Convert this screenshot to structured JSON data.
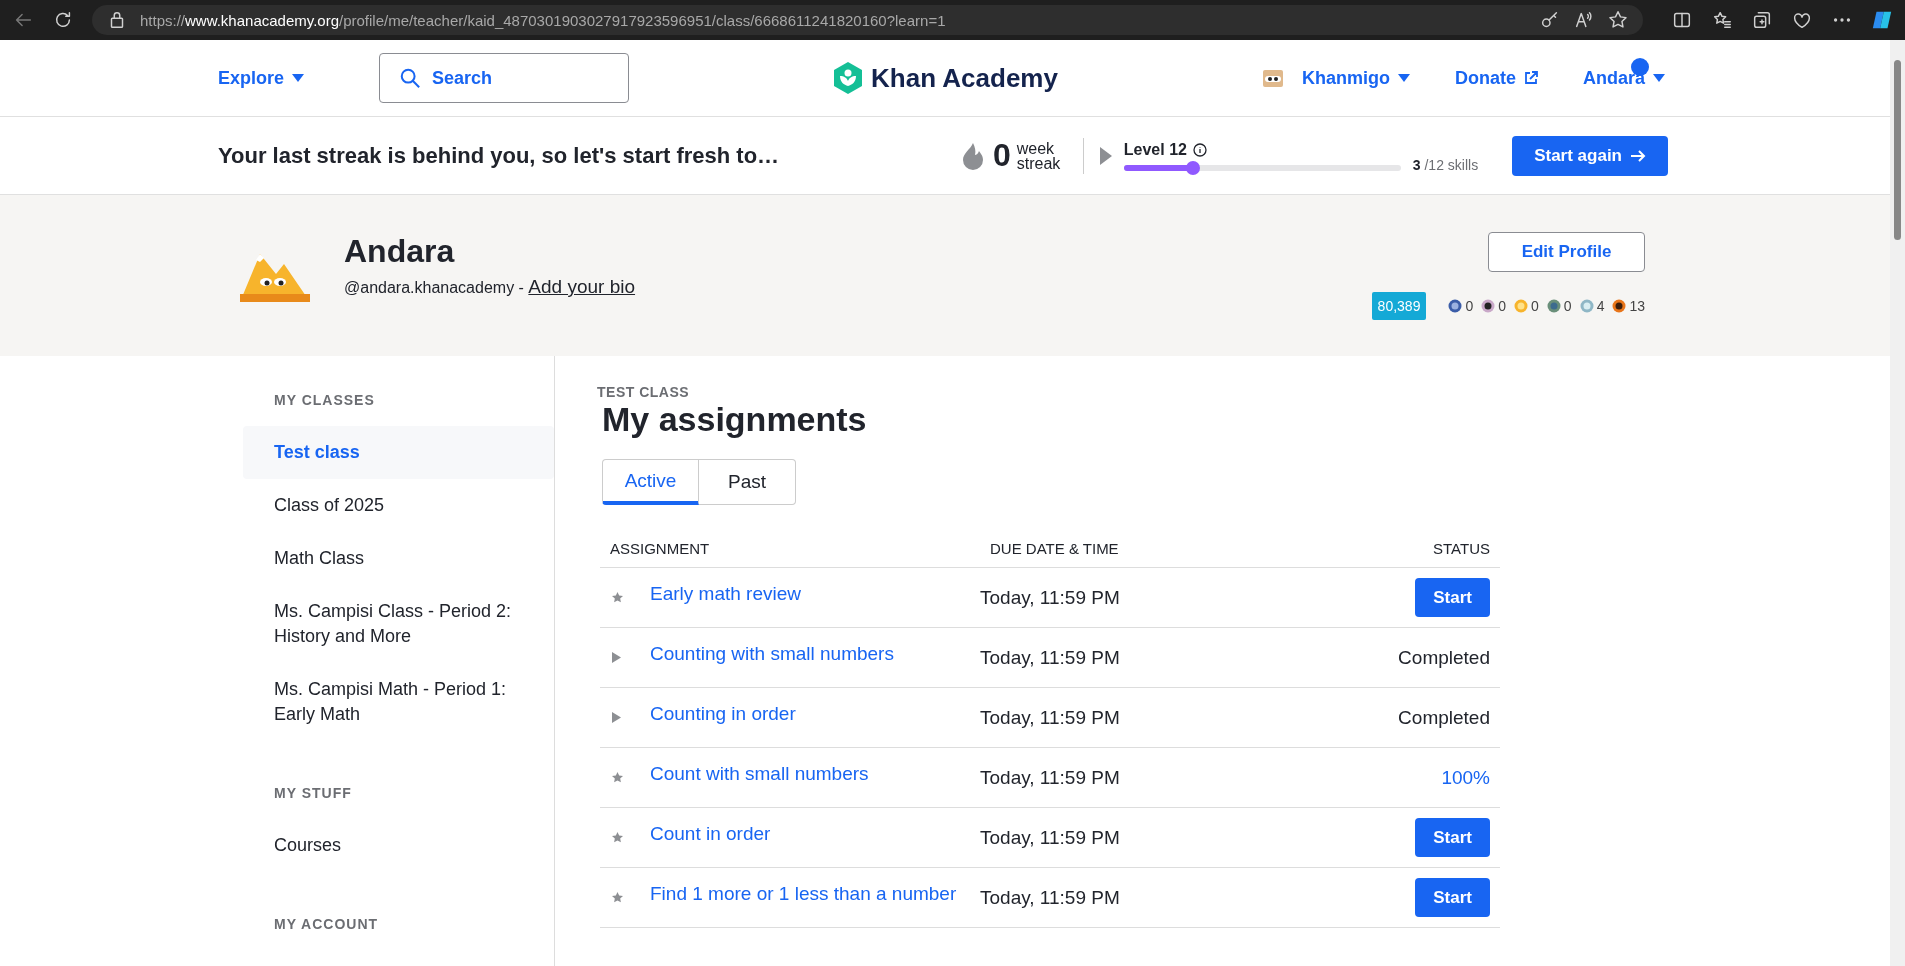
{
  "browser": {
    "url": {
      "scheme": "https://",
      "host": "www.khanacademy.org",
      "path": "/profile/me/teacher/kaid_4870301903027917923596951/class/6668611241820160?learn=1"
    }
  },
  "header": {
    "explore": "Explore",
    "search": {
      "placeholder": "Search"
    },
    "logo": "Khan Academy",
    "khanmigo": "Khanmigo",
    "donate": "Donate",
    "user": "Andara",
    "has_notification": true
  },
  "streak_bar": {
    "message": "Your last streak is behind you, so let's start fresh to…",
    "count": "0",
    "unit": "week streak",
    "level_label": "Level 12",
    "level": 0.25,
    "skills_done": "3",
    "skills_total": "/12 skills",
    "button": "Start again"
  },
  "profile": {
    "name": "Andara",
    "username": "@andara.khanacademy -",
    "bio_link": "Add your bio",
    "edit_button": "Edit Profile",
    "points": "80,389",
    "badges": [
      {
        "kind": "challenge",
        "count": "0"
      },
      {
        "kind": "black-hole",
        "count": "0"
      },
      {
        "kind": "sun",
        "count": "0"
      },
      {
        "kind": "earth",
        "count": "0"
      },
      {
        "kind": "moon",
        "count": "4"
      },
      {
        "kind": "meteorite",
        "count": "13"
      }
    ]
  },
  "sidebar": {
    "sections": [
      {
        "title": "MY CLASSES",
        "items": [
          {
            "label": "Test class",
            "selected": true
          },
          {
            "label": "Class of 2025",
            "selected": false
          },
          {
            "label": "Math Class",
            "selected": false
          },
          {
            "label": "Ms. Campisi Class - Period 2: History and More",
            "selected": false
          },
          {
            "label": "Ms. Campisi Math - Period 1: Early Math",
            "selected": false
          }
        ]
      },
      {
        "title": "MY STUFF",
        "items": [
          {
            "label": "Courses",
            "selected": false
          }
        ]
      },
      {
        "title": "MY ACCOUNT"
      }
    ]
  },
  "main": {
    "eyebrow": "TEST CLASS",
    "title": "My assignments",
    "tabs": [
      {
        "label": "Active",
        "selected": true
      },
      {
        "label": "Past",
        "selected": false
      }
    ],
    "table": {
      "columns": [
        "ASSIGNMENT",
        "DUE DATE & TIME",
        "STATUS"
      ],
      "rows": [
        {
          "expandable": false,
          "name": "Early math review",
          "due": "Today, 11:59 PM",
          "status": {
            "kind": "button",
            "text": "Start"
          }
        },
        {
          "expandable": true,
          "name": "Counting with small numbers",
          "due": "Today, 11:59 PM",
          "status": {
            "kind": "text",
            "text": "Completed"
          }
        },
        {
          "expandable": true,
          "name": "Counting in order",
          "due": "Today, 11:59 PM",
          "status": {
            "kind": "text",
            "text": "Completed"
          }
        },
        {
          "expandable": false,
          "name": "Count with small numbers",
          "due": "Today, 11:59 PM",
          "status": {
            "kind": "score",
            "text": "100%"
          }
        },
        {
          "expandable": false,
          "name": "Count in order",
          "due": "Today, 11:59 PM",
          "status": {
            "kind": "button",
            "text": "Start"
          }
        },
        {
          "expandable": false,
          "name": "Find 1 more or 1 less than a number",
          "due": "Today, 11:59 PM",
          "status": {
            "kind": "button",
            "text": "Start"
          }
        }
      ]
    }
  }
}
